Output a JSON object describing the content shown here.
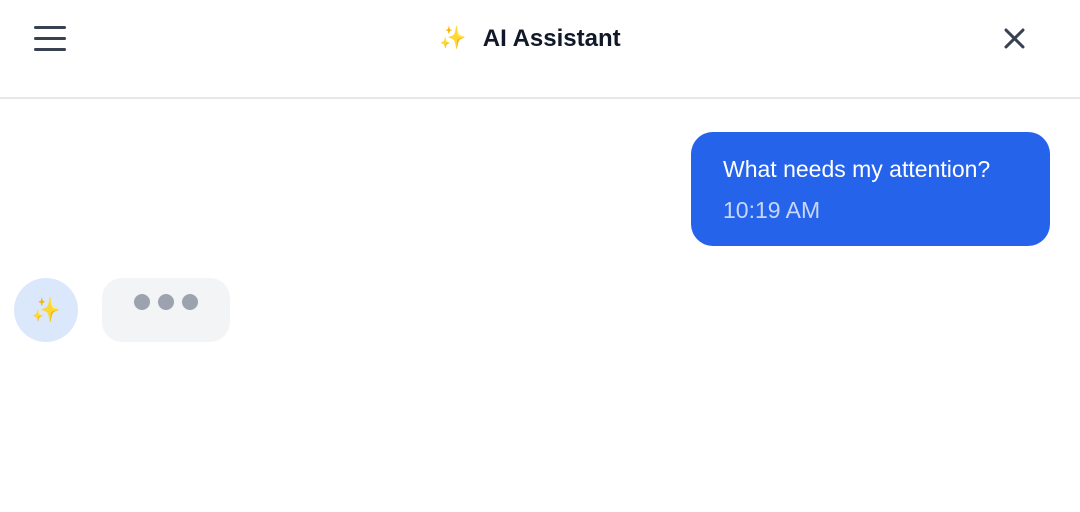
{
  "header": {
    "title": "AI Assistant",
    "title_icon": "sparkles-icon",
    "title_glyph": "✨",
    "menu_icon": "hamburger-menu-icon",
    "close_icon": "close-icon"
  },
  "messages": [
    {
      "role": "user",
      "text": "What needs my attention?",
      "time": "10:19 AM"
    },
    {
      "role": "assistant",
      "avatar_icon": "sparkles-icon",
      "avatar_glyph": "✨",
      "status": "typing"
    }
  ],
  "colors": {
    "accent": "#2563eb",
    "avatar_bg": "#dbe8fc",
    "typing_bg": "#f3f4f6",
    "typing_dot": "#9ca3af",
    "sparkle": "#f5b800"
  }
}
